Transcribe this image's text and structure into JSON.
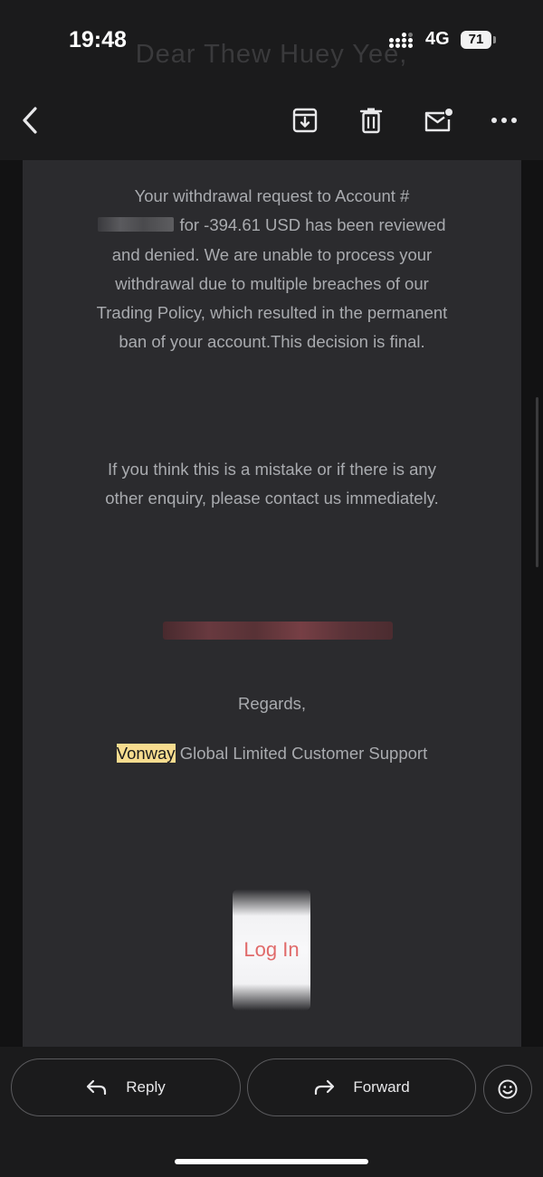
{
  "status_bar": {
    "time": "19:48",
    "network": "4G",
    "battery": "71",
    "ghost_greeting": "Dear Thew Huey Yee,"
  },
  "toolbar": {
    "back_icon": "chevron-left-icon",
    "archive_icon": "archive-icon",
    "delete_icon": "trash-icon",
    "mark_unread_icon": "mark-unread-icon",
    "more_icon": "more-horizontal-icon"
  },
  "email": {
    "paragraph1_start": "Your withdrawal request to Account #",
    "paragraph1_rest": "for -394.61 USD has been reviewed and denied. We are unable to process your withdrawal due to multiple breaches of our Trading Policy, which resulted in the permanent ban of your account.This decision is final.",
    "paragraph2": "If you think this is a mistake or if there is any other enquiry, please contact us immediately.",
    "regards": "Regards,",
    "signature_highlight": "Vonway",
    "signature_rest": " Global Limited Customer Support",
    "login_label": "Log In"
  },
  "actions": {
    "reply_label": "Reply",
    "forward_label": "Forward",
    "emoji_icon": "smiley-icon"
  },
  "colors": {
    "background": "#151516",
    "card": "#2b2b2e",
    "body_text": "#a9abaf",
    "highlight": "#f7dc8f",
    "login_text": "#e06a6a"
  }
}
